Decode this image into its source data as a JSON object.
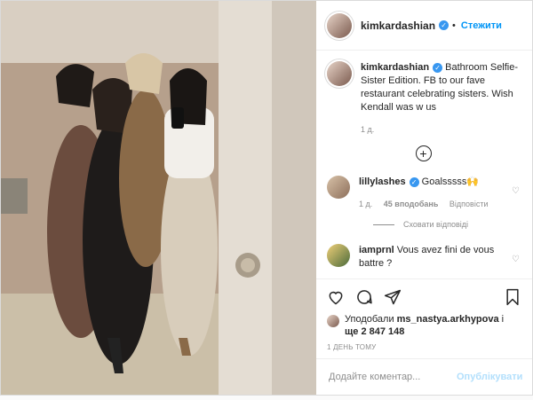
{
  "header": {
    "username": "kimkardashian",
    "follow_label": "Стежити",
    "dot": "•"
  },
  "caption": {
    "username": "kimkardashian",
    "text": "Bathroom Selfie-Sister Edition. FB to our fave restaurant celebrating sisters. Wish Kendall was w us",
    "time": "1 д."
  },
  "comments": [
    {
      "username": "lillylashes",
      "text": "Goalsssss🙌",
      "time": "1 д.",
      "likes": "45 вподобань",
      "reply": "Відповісти",
      "verified": true
    },
    {
      "username": "iamprnl",
      "text": "Vous avez fini de vous battre ?",
      "verified": false
    }
  ],
  "hide_replies": "Сховати відповіді",
  "likes": {
    "prefix": "Уподобали",
    "user": "ms_nastya.arkhypova",
    "and": "і",
    "rest": "ще 2 847 148"
  },
  "posted_ago": "1 ДЕНЬ ТОМУ",
  "add_comment": {
    "placeholder": "Додайте коментар...",
    "publish_label": "Опублікувати"
  },
  "icons": [
    "heart-icon",
    "comment-icon",
    "share-icon",
    "bookmark-icon",
    "plus-icon",
    "verified-icon"
  ],
  "colors": {
    "link": "#0095f6",
    "verified": "#3897f0",
    "muted": "#8e8e8e",
    "publish_disabled": "#b2dffc"
  }
}
